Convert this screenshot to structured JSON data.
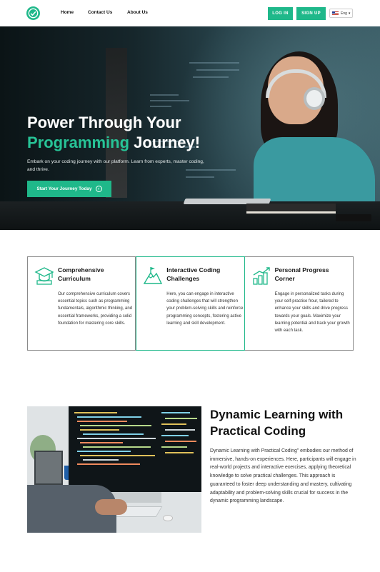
{
  "nav": {
    "links": [
      "Home",
      "Contact Us",
      "About Us"
    ],
    "login_label": "LOG IN",
    "signup_label": "SIGN UP",
    "language": "Eng",
    "flag_icon": "us-flag-icon"
  },
  "hero": {
    "title_line1": "Power Through Your",
    "title_accent": "Programming",
    "title_rest": " Journey!",
    "subtitle": "Embark on your coding journey with our platform. Learn from experts, master coding, and thrive.",
    "cta_label": "Start Your Journey Today",
    "cta_icon": "arrow-circle-icon"
  },
  "features": [
    {
      "icon": "graduation-cap-icon",
      "title": "Comprehensive Curriculum",
      "text": "Our comprehensive curriculum covers essential topics such as programming fundamentals, algorithmic thinking, and essential frameworks, providing a solid foundation for mastering core skills."
    },
    {
      "icon": "mountain-flag-icon",
      "title": "Interactive Coding Challenges",
      "text": "Here, you can engage in interactive coding challenges that will strengthen your problem-solving skills and reinforce programming concepts, fostering active learning and skill development."
    },
    {
      "icon": "growth-chart-icon",
      "title": "Personal Progress Corner",
      "text": "Engage in personalized tasks during your self-practice frour, tailored to enhance your skills and drive progress towards your goals. Maximize your learning potential and track your growth with each task."
    }
  ],
  "dynamic": {
    "title": "Dynamic Learning with Practical Coding",
    "text": "Dynamic Learning with Practical Coding\" embodies our method of immersive, hands-on experiences. Here, participants will engage in real-world projects and interactive exercises, applying theoretical knowledge to solve practical challenges. This approach is guaranteed to foster deep understanding and mastery, cultivating adaptability and problem-solving skills crucial for success in the dynamic programming landscape."
  },
  "colors": {
    "accent": "#1fb88a",
    "accent_text": "#27c497",
    "hero_bg": "#16262b"
  }
}
